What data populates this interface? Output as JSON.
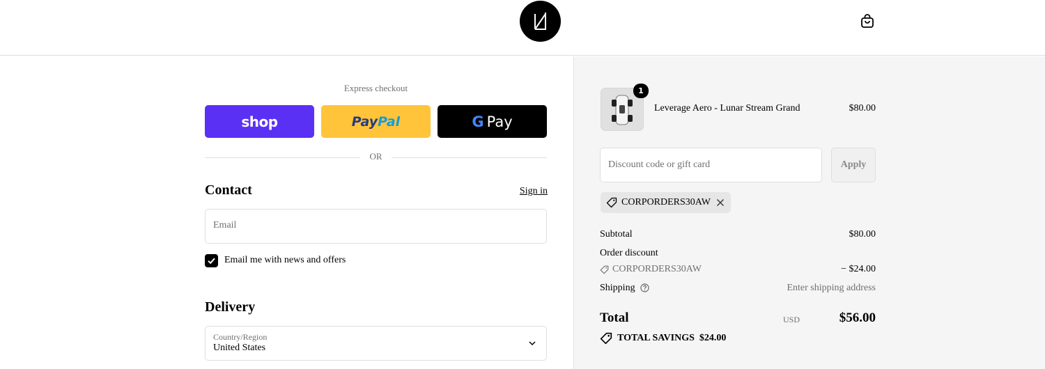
{
  "header": {
    "logo_icon": "brand-logo",
    "cart_icon": "shopping-bag-icon"
  },
  "express": {
    "label": "Express checkout",
    "shop_label": "shop",
    "paypal_label_1": "Pay",
    "paypal_label_2": "Pal",
    "gpay_g": "G",
    "gpay_label": "Pay",
    "or_label": "OR"
  },
  "contact": {
    "title": "Contact",
    "sign_in": "Sign in",
    "email_placeholder": "Email",
    "newsletter_label": "Email me with news and offers",
    "newsletter_checked": true
  },
  "delivery": {
    "title": "Delivery",
    "country_label": "Country/Region",
    "country_value": "United States"
  },
  "summary": {
    "item": {
      "quantity": "1",
      "name": "Leverage Aero - Lunar Stream Grand",
      "price": "$80.00"
    },
    "discount_placeholder": "Discount code or gift card",
    "apply_label": "Apply",
    "applied_code": "CORPORDERS30AW",
    "subtotal_label": "Subtotal",
    "subtotal_value": "$80.00",
    "order_discount_label": "Order discount",
    "discount_code": "CORPORDERS30AW",
    "discount_value": "− $24.00",
    "shipping_label": "Shipping",
    "shipping_value": "Enter shipping address",
    "total_label": "Total",
    "total_currency": "USD",
    "total_value": "$56.00",
    "savings_label": "TOTAL SAVINGS",
    "savings_value": "$24.00"
  },
  "colors": {
    "shop": "#5a31f4",
    "paypal": "#ffc439",
    "gpay": "#000000",
    "summary_bg": "#f5f5f5"
  }
}
